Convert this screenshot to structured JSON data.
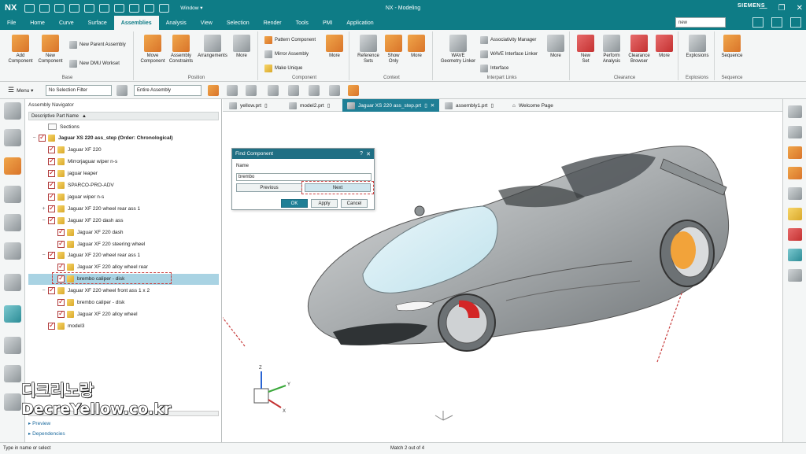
{
  "titlebar": {
    "app": "NX",
    "title": "NX - Modeling",
    "window_menu": "Window ▾",
    "brand": "SIEMENS",
    "search_value": "new"
  },
  "menubar": {
    "items": [
      "File",
      "Home",
      "Curve",
      "Surface",
      "Assemblies",
      "Analysis",
      "View",
      "Selection",
      "Render",
      "Tools",
      "PMI",
      "Application"
    ],
    "active": "Assemblies"
  },
  "ribbon": {
    "base": {
      "label": "Base",
      "add": "Add\nComponent",
      "new": "New\nComponent",
      "new_parent": "New Parent Assembly",
      "new_dmu": "New DMU Workset"
    },
    "position": {
      "label": "Position",
      "move": "Move\nComponent",
      "constraints": "Assembly\nConstraints",
      "arrangements": "Arrangements",
      "more": "More"
    },
    "component": {
      "label": "Component",
      "pattern": "Pattern Component",
      "mirror": "Mirror Assembly",
      "unique": "Make Unique",
      "more": "More"
    },
    "context": {
      "label": "Context",
      "reference": "Reference\nSets",
      "show_only": "Show\nOnly",
      "more": "More"
    },
    "interpart": {
      "label": "Interpart Links",
      "wave": "WAVE\nGeometry Linker",
      "assoc": "Associativity Manager",
      "wave_linker": "WAVE Interface Linker",
      "interface": "Interface",
      "more": "More"
    },
    "clearance": {
      "label": "Clearance",
      "new_set": "New\nSet",
      "perform": "Perform\nAnalysis",
      "browser": "Clearance\nBrowser",
      "more": "More"
    },
    "explosions": {
      "label": "Explosions",
      "btn": "Explosions"
    },
    "sequence": {
      "label": "Sequence",
      "btn": "Sequence"
    }
  },
  "toolbar": {
    "menu": "Menu ▾",
    "filter": "No Selection Filter",
    "scope": "Entire Assembly"
  },
  "navigator": {
    "title": "Assembly Navigator",
    "column": "Descriptive Part Name",
    "rows": [
      {
        "label": "Sections",
        "indent": 1,
        "type": "folder"
      },
      {
        "label": "Jaguar XS 220 ass_step (Order: Chronological)",
        "indent": 0,
        "type": "root",
        "toggle": "−"
      },
      {
        "label": "Jaguar XF 220",
        "indent": 1,
        "type": "part"
      },
      {
        "label": "Mirrorjaguar wiper n-s",
        "indent": 1,
        "type": "part"
      },
      {
        "label": "jaguar leaper",
        "indent": 1,
        "type": "part"
      },
      {
        "label": "SPARCO-PRO-ADV",
        "indent": 1,
        "type": "part"
      },
      {
        "label": "jaguar wiper n-s",
        "indent": 1,
        "type": "part"
      },
      {
        "label": "Jaguar XF 220 wheel rear ass 1",
        "indent": 1,
        "type": "part",
        "toggle": "+"
      },
      {
        "label": "Jaguar XF 220 dash ass",
        "indent": 1,
        "type": "part",
        "toggle": "−"
      },
      {
        "label": "Jaguar XF 220 dash",
        "indent": 2,
        "type": "part"
      },
      {
        "label": "Jaguar XF 220 steering wheel",
        "indent": 2,
        "type": "part"
      },
      {
        "label": "Jaguar XF 220 wheel rear ass 1",
        "indent": 1,
        "type": "part",
        "toggle": "−"
      },
      {
        "label": "Jaguar XF 220 alloy wheel rear",
        "indent": 2,
        "type": "part"
      },
      {
        "label": "brembo caliper - disk",
        "indent": 2,
        "type": "part",
        "selected": true
      },
      {
        "label": "Jaguar XF 220 wheel front ass 1 x 2",
        "indent": 1,
        "type": "part",
        "toggle": "−"
      },
      {
        "label": "brembo caliper - disk",
        "indent": 2,
        "type": "part"
      },
      {
        "label": "Jaguar XF 220 alloy wheel",
        "indent": 2,
        "type": "part"
      },
      {
        "label": "model3",
        "indent": 1,
        "type": "part"
      }
    ],
    "footer": [
      "Preview",
      "Dependencies"
    ]
  },
  "tabs": [
    {
      "label": "yellow.prt"
    },
    {
      "label": "model2.prt"
    },
    {
      "label": "Jaguar XS 220 ass_step.prt",
      "active": true
    },
    {
      "label": "assembly1.prt"
    },
    {
      "label": "Welcome Page"
    }
  ],
  "dialog": {
    "title": "Find Component",
    "name_label": "Name",
    "name_value": "brembo",
    "previous": "Previous",
    "next": "Next",
    "ok": "OK",
    "apply": "Apply",
    "cancel": "Cancel"
  },
  "canvas": {
    "axis_x": "X",
    "axis_y": "Y",
    "axis_z": "Z"
  },
  "status": {
    "left": "Type in name or select",
    "mid": "Match 2 out of 4"
  },
  "watermark": {
    "line1": "디크리노랑",
    "line2": "DecreYellow.co.kr"
  },
  "colors": {
    "accent": "#0e7c86",
    "selection": "#a9d3e3",
    "highlight": "#f2a33a",
    "annotation": "#c94040"
  }
}
